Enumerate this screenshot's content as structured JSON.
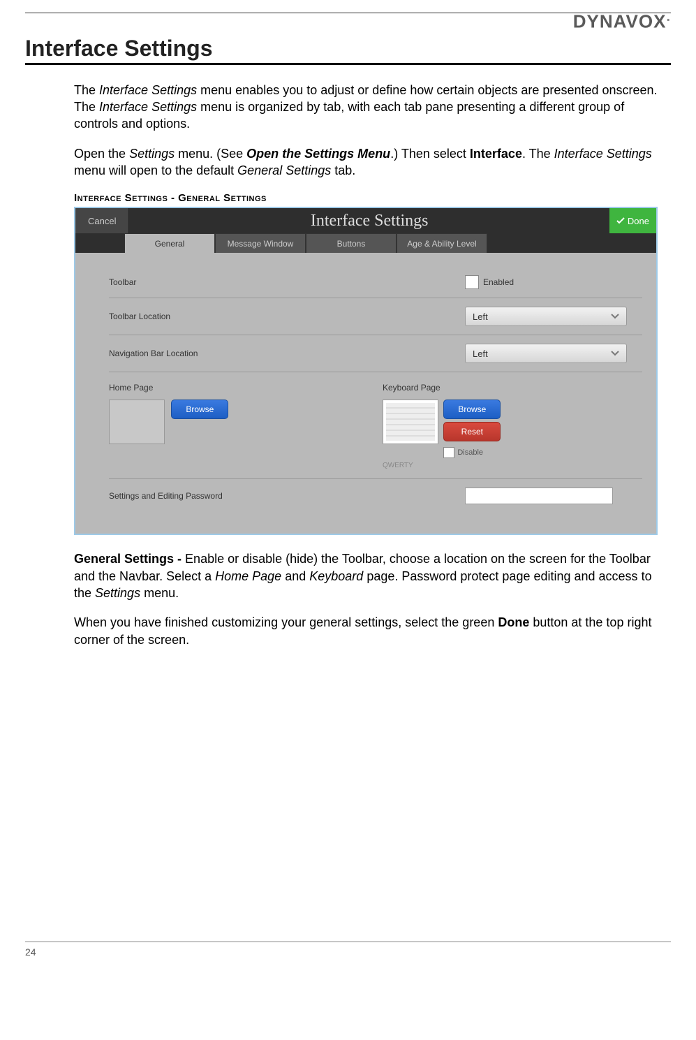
{
  "brand": "DYNAVOX",
  "page_title": "Interface Settings",
  "intro_p1_a": "The ",
  "intro_p1_b": "Interface Settings",
  "intro_p1_c": " menu enables you to adjust or define how certain objects are presented onscreen. The ",
  "intro_p1_d": "Interface Settings",
  "intro_p1_e": " menu is organized by tab, with each tab pane presenting a different group of controls and options.",
  "intro_p2_a": "Open the ",
  "intro_p2_b": "Settings",
  "intro_p2_c": " menu. (See ",
  "intro_p2_d": "Open the Settings Menu",
  "intro_p2_e": ".) Then select ",
  "intro_p2_f": "Interface",
  "intro_p2_g": ". The ",
  "intro_p2_h": "Interface Settings",
  "intro_p2_i": " menu will open to the default ",
  "intro_p2_j": "General Settings",
  "intro_p2_k": " tab.",
  "caption": "Interface Settings - General Settings",
  "shot": {
    "cancel": "Cancel",
    "title": "Interface Settings",
    "done": "Done",
    "tabs": {
      "general": "General",
      "msgwin": "Message Window",
      "buttons": "Buttons",
      "age": "Age & Ability Level"
    },
    "rows": {
      "toolbar": {
        "label": "Toolbar",
        "chk": "Enabled"
      },
      "toolbar_loc": {
        "label": "Toolbar Location",
        "value": "Left"
      },
      "nav_loc": {
        "label": "Navigation Bar Location",
        "value": "Left"
      },
      "home": {
        "label": "Home Page",
        "browse": "Browse"
      },
      "keyboard": {
        "label": "Keyboard Page",
        "browse": "Browse",
        "reset": "Reset",
        "disable": "Disable",
        "name": "QWERTY"
      },
      "password": {
        "label": "Settings and Editing Password"
      }
    }
  },
  "desc_a": "General Settings - ",
  "desc_b": "Enable or disable (hide) the Toolbar, choose a location on the screen for the Toolbar and the Navbar. Select a ",
  "desc_c": "Home Page",
  "desc_d": " and ",
  "desc_e": "Keyboard",
  "desc_f": " page. Password protect page editing and access to the ",
  "desc_g": "Settings",
  "desc_h": " menu.",
  "closing_a": "When you have finished customizing your general settings, select the green ",
  "closing_b": "Done",
  "closing_c": " button at the top right corner of the screen.",
  "page_number": "24"
}
